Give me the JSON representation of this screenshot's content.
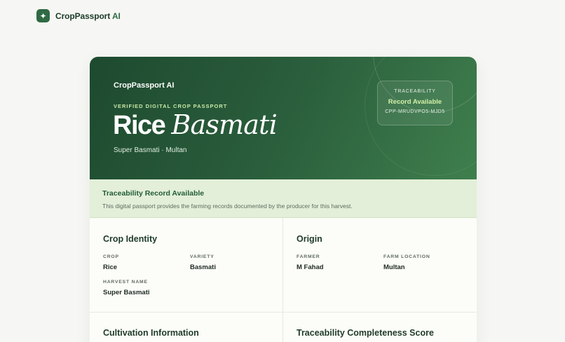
{
  "app": {
    "logo_icon": "sparkle-icon",
    "brand_name": "CropPassport",
    "brand_suffix": " AI"
  },
  "hero": {
    "brand": "CropPassport AI",
    "brand_icon": "sparkle-icon",
    "kicker": "VERIFIED DIGITAL CROP PASSPORT",
    "crop": "Rice",
    "variety": "Basmati",
    "subtitle": "Super Basmati · Multan"
  },
  "badge": {
    "label": "TRACEABILITY",
    "status": "Record Available",
    "record_id": "CPP-MRUDVPO5-MJD5"
  },
  "banner": {
    "title": "Traceability Record Available",
    "text": "This digital passport provides the farming records documented by the producer for this harvest."
  },
  "crop_identity": {
    "title": "Crop Identity",
    "crop_label": "CROP",
    "crop_value": "Rice",
    "variety_label": "VARIETY",
    "variety_value": "Basmati",
    "harvest_label": "HARVEST NAME",
    "harvest_value": "Super Basmati"
  },
  "origin": {
    "title": "Origin",
    "farmer_label": "FARMER",
    "farmer_value": "M Fahad",
    "location_label": "FARM LOCATION",
    "location_value": "Multan"
  },
  "sections": {
    "cultivation_title": "Cultivation Information",
    "score_title": "Traceability Completeness Score"
  },
  "colors": {
    "brand_green": "#2f6a44",
    "hero_dark": "#1e4a2f",
    "accent_lime": "#c9e8a7",
    "banner_bg": "#e3efd8"
  }
}
